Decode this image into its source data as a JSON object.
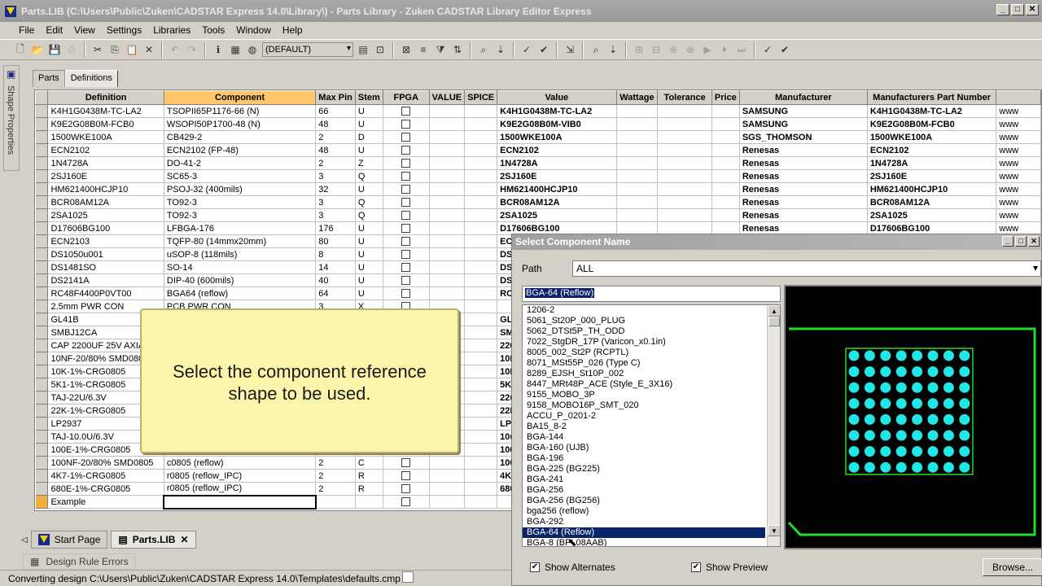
{
  "window": {
    "title": "Parts.LIB (C:\\Users\\Public\\Zuken\\CADSTAR Express 14.0\\Library\\) - Parts Library - Zuken CADSTAR Library Editor Express"
  },
  "menu": [
    "File",
    "Edit",
    "View",
    "Settings",
    "Libraries",
    "Tools",
    "Window",
    "Help"
  ],
  "toolbar": {
    "combo_value": "(DEFAULT)"
  },
  "side_panel": {
    "label": "Shape Properties"
  },
  "tabs": [
    "Parts",
    "Definitions"
  ],
  "grid": {
    "columns": [
      "Definition",
      "Component",
      "Max Pin",
      "Stem",
      "FPGA",
      "VALUE",
      "SPICE",
      "Value",
      "Wattage",
      "Tolerance",
      "Price",
      "Manufacturer",
      "Manufacturers Part Number",
      ""
    ],
    "rows": [
      [
        "K4H1G0438M-TC-LA2",
        "TSOPII65P1176-66 (N)",
        "66",
        "U",
        "",
        "",
        "",
        "K4H1G0438M-TC-LA2",
        "",
        "",
        "",
        "SAMSUNG",
        "K4H1G0438M-TC-LA2",
        "www"
      ],
      [
        "K9E2G08B0M-FCB0",
        "WSOPI50P1700-48 (N)",
        "48",
        "U",
        "",
        "",
        "",
        "K9E2G08B0M-VIB0",
        "",
        "",
        "",
        "SAMSUNG",
        "K9E2G08B0M-FCB0",
        "www"
      ],
      [
        "1500WKE100A",
        "CB429-2",
        "2",
        "D",
        "",
        "",
        "",
        "1500WKE100A",
        "",
        "",
        "",
        "SGS_THOMSON",
        "1500WKE100A",
        "www"
      ],
      [
        "ECN2102",
        "ECN2102 (FP-48)",
        "48",
        "U",
        "",
        "",
        "",
        "ECN2102",
        "",
        "",
        "",
        "Renesas",
        "ECN2102",
        "www"
      ],
      [
        "1N4728A",
        "DO-41-2",
        "2",
        "Z",
        "",
        "",
        "",
        "1N4728A",
        "",
        "",
        "",
        "Renesas",
        "1N4728A",
        "www"
      ],
      [
        "2SJ160E",
        "SC65-3",
        "3",
        "Q",
        "",
        "",
        "",
        "2SJ160E",
        "",
        "",
        "",
        "Renesas",
        "2SJ160E",
        "www"
      ],
      [
        "HM621400HCJP10",
        "PSOJ-32 (400mils)",
        "32",
        "U",
        "",
        "",
        "",
        "HM621400HCJP10",
        "",
        "",
        "",
        "Renesas",
        "HM621400HCJP10",
        "www"
      ],
      [
        "BCR08AM12A",
        "TO92-3",
        "3",
        "Q",
        "",
        "",
        "",
        "BCR08AM12A",
        "",
        "",
        "",
        "Renesas",
        "BCR08AM12A",
        "www"
      ],
      [
        "2SA1025",
        "TO92-3",
        "3",
        "Q",
        "",
        "",
        "",
        "2SA1025",
        "",
        "",
        "",
        "Renesas",
        "2SA1025",
        "www"
      ],
      [
        "D17606BG100",
        "LFBGA-176",
        "176",
        "U",
        "",
        "",
        "",
        "D17606BG100",
        "",
        "",
        "",
        "Renesas",
        "D17606BG100",
        "www"
      ],
      [
        "ECN2103",
        "TQFP-80 (14mmx20mm)",
        "80",
        "U",
        "",
        "",
        "",
        "EC",
        "",
        "",
        "",
        "",
        "",
        ""
      ],
      [
        "DS1050u001",
        "uSOP-8 (118mils)",
        "8",
        "U",
        "",
        "",
        "",
        "DS",
        "",
        "",
        "",
        "",
        "",
        ""
      ],
      [
        "DS1481SO",
        "SO-14",
        "14",
        "U",
        "",
        "",
        "",
        "DS",
        "",
        "",
        "",
        "",
        "",
        ""
      ],
      [
        "DS2141A",
        "DIP-40 (600mils)",
        "40",
        "U",
        "",
        "",
        "",
        "DS",
        "",
        "",
        "",
        "",
        "",
        ""
      ],
      [
        "RC48F4400P0VT00",
        "BGA64 (reflow)",
        "64",
        "U",
        "",
        "",
        "",
        "RC",
        "",
        "",
        "",
        "",
        "",
        ""
      ],
      [
        "2.5mm PWR CON",
        "PCB PWR CON",
        "3",
        "X",
        "",
        "",
        "",
        "",
        "",
        "",
        "",
        "",
        "",
        ""
      ],
      [
        "GL41B",
        "",
        "",
        "",
        "",
        "",
        "",
        "GL",
        "",
        "",
        "",
        "",
        "",
        ""
      ],
      [
        "SMBJ12CA",
        "",
        "",
        "",
        "",
        "",
        "",
        "SM",
        "",
        "",
        "",
        "",
        "",
        ""
      ],
      [
        "CAP 2200UF 25V AXIAL",
        "",
        "",
        "",
        "",
        "",
        "",
        "220",
        "",
        "",
        "",
        "",
        "",
        ""
      ],
      [
        "10NF-20/80% SMD0805",
        "",
        "",
        "",
        "",
        "",
        "",
        "10N",
        "",
        "",
        "",
        "",
        "",
        ""
      ],
      [
        "10K-1%-CRG0805",
        "",
        "",
        "",
        "",
        "",
        "",
        "10K",
        "",
        "",
        "",
        "",
        "",
        ""
      ],
      [
        "5K1-1%-CRG0805",
        "",
        "",
        "",
        "",
        "",
        "",
        "5K1",
        "",
        "",
        "",
        "",
        "",
        ""
      ],
      [
        "TAJ-22U/6.3V",
        "",
        "",
        "",
        "",
        "",
        "",
        "22u",
        "",
        "",
        "",
        "",
        "",
        ""
      ],
      [
        "22K-1%-CRG0805",
        "",
        "",
        "",
        "",
        "",
        "",
        "22K",
        "",
        "",
        "",
        "",
        "",
        ""
      ],
      [
        "LP2937",
        "",
        "",
        "",
        "",
        "",
        "",
        "LP",
        "",
        "",
        "",
        "",
        "",
        ""
      ],
      [
        "TAJ-10.0U/6.3V",
        "",
        "",
        "",
        "",
        "",
        "",
        "10u",
        "",
        "",
        "",
        "",
        "",
        ""
      ],
      [
        "100E-1%-CRG0805",
        "",
        "",
        "",
        "",
        "",
        "",
        "100",
        "",
        "",
        "",
        "",
        "",
        ""
      ],
      [
        "100NF-20/80% SMD0805",
        "c0805 (reflow)",
        "2",
        "C",
        "",
        "",
        "",
        "100",
        "",
        "",
        "",
        "",
        "",
        ""
      ],
      [
        "4K7-1%-CRG0805",
        "r0805 (reflow_IPC)",
        "2",
        "R",
        "",
        "",
        "",
        "4K7",
        "",
        "",
        "",
        "",
        "",
        ""
      ],
      [
        "680E-1%-CRG0805",
        "r0805 (reflow_IPC)",
        "2",
        "R",
        "",
        "",
        "",
        "680",
        "",
        "",
        "",
        "",
        "",
        ""
      ],
      [
        "Example",
        "",
        "",
        "",
        "",
        "",
        "",
        "",
        "",
        "",
        "",
        "",
        "",
        ""
      ]
    ]
  },
  "callout": {
    "line1": "Select the component reference",
    "line2": "shape to be used."
  },
  "doc_tabs": [
    "Start Page",
    "Parts.LIB"
  ],
  "drc_tab": "Design Rule Errors",
  "status": "Converting design C:\\Users\\Public\\Zuken\\CADSTAR Express 14.0\\Templates\\defaults.cmp",
  "dialog": {
    "title": "Select Component Name",
    "path_label": "Path",
    "path_value": "ALL",
    "name_value": "BGA-64 (Reflow)",
    "names": [
      "1206-2",
      "5061_St20P_000_PLUG",
      "5062_DTSt5P_TH_ODD",
      "7022_StgDR_17P (Varicon_x0.1in)",
      "8005_002_St2P (RCPTL)",
      "8071_MSt55P_026 (Type C)",
      "8289_EJSH_St10P_002",
      "8447_MRt48P_ACE (Style_E_3X16)",
      "9155_MOBO_3P",
      "9158_MOBO16P_SMT_020",
      "ACCU_P_0201-2",
      "BA15_8-2",
      "BGA-144",
      "BGA-160 (UJB)",
      "BGA-196",
      "BGA-225 (BG225)",
      "BGA-241",
      "BGA-256",
      "BGA-256 (BG256)",
      "bga256 (reflow)",
      "BGA-292",
      "BGA-64 (Reflow)",
      "BGA-8 (BP_08AAB)"
    ],
    "selected_index": 21,
    "show_alternates": "Show Alternates",
    "show_preview": "Show Preview",
    "browse": "Browse..."
  },
  "colors": {
    "outline": "#22dd22",
    "pad": "#22e5e5",
    "selection": "#0a246a"
  }
}
